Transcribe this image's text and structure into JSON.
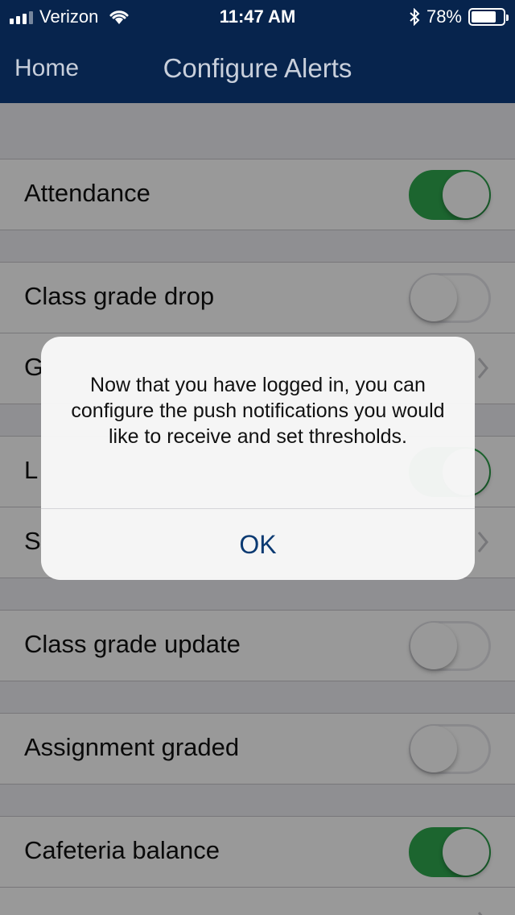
{
  "status_bar": {
    "carrier": "Verizon",
    "time": "11:47 AM",
    "battery": "78%",
    "battery_level": 0.78,
    "icons": [
      "signal-icon",
      "wifi-icon",
      "bluetooth-icon",
      "battery-icon"
    ]
  },
  "nav": {
    "back_label": "Home",
    "title": "Configure Alerts"
  },
  "sections": [
    {
      "rows": [
        {
          "label": "Attendance",
          "type": "toggle",
          "on": true
        }
      ]
    },
    {
      "rows": [
        {
          "label": "Class grade drop",
          "type": "toggle",
          "on": false
        },
        {
          "label": "G",
          "type": "chevron"
        }
      ]
    },
    {
      "rows": [
        {
          "label": "L",
          "type": "toggle",
          "on": true
        },
        {
          "label": "S",
          "type": "chevron"
        }
      ]
    },
    {
      "rows": [
        {
          "label": "Class grade update",
          "type": "toggle",
          "on": false
        }
      ]
    },
    {
      "rows": [
        {
          "label": "Assignment graded",
          "type": "toggle",
          "on": false
        }
      ]
    },
    {
      "rows": [
        {
          "label": "Cafeteria balance",
          "type": "toggle",
          "on": true
        },
        {
          "label": "",
          "type": "chevron"
        }
      ]
    }
  ],
  "colors": {
    "nav_bg": "#07244d",
    "toggle_on": "#2fa84f",
    "alert_button": "#0b3a72"
  },
  "alert": {
    "message": "Now that you have logged in, you can configure the push notifications you would like to receive and set thresholds.",
    "ok_label": "OK"
  }
}
